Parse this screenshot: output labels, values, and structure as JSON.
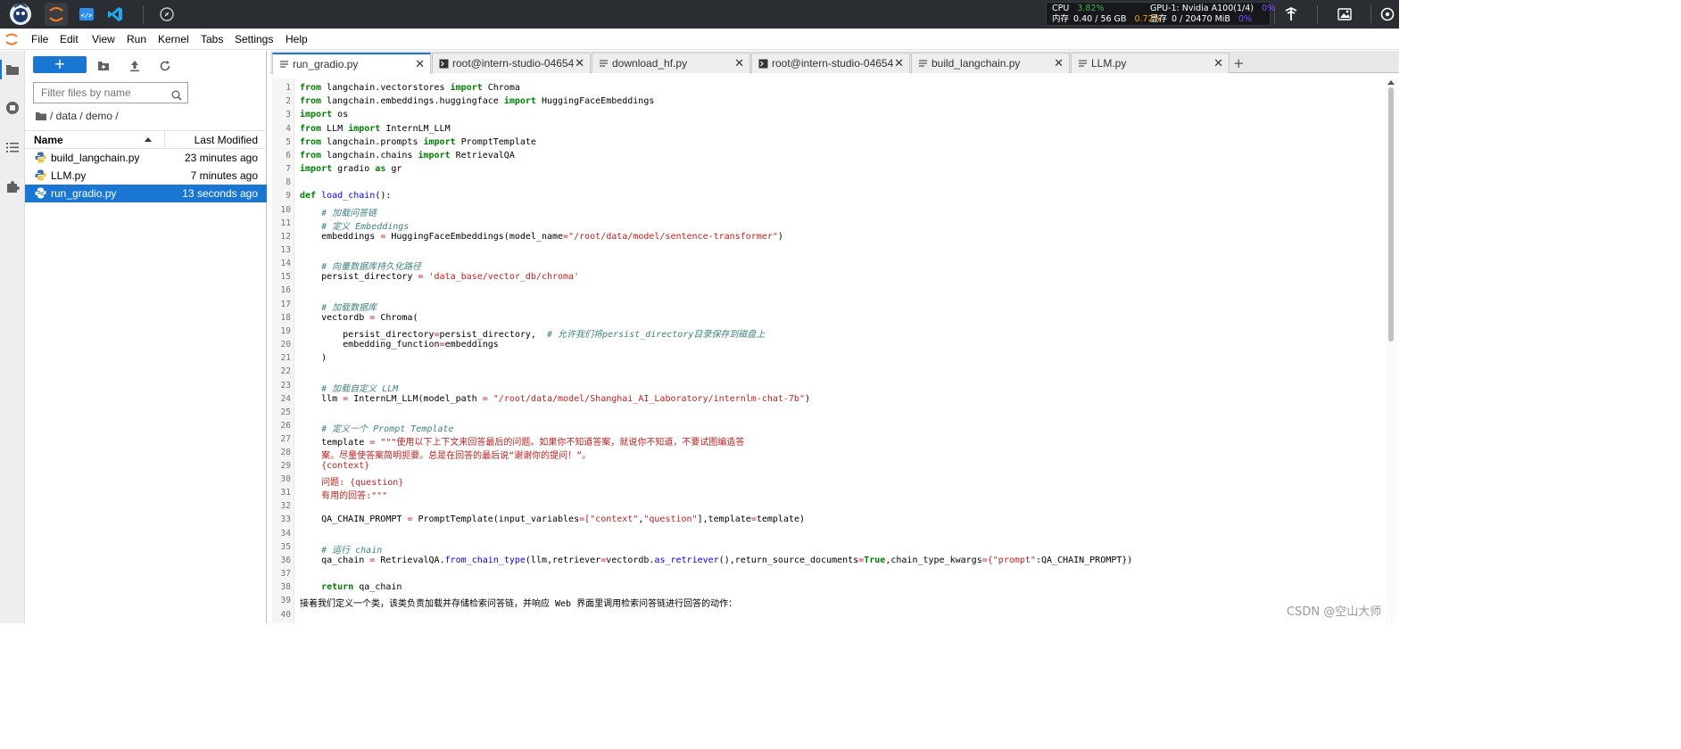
{
  "monitor": {
    "cpu_label": "CPU",
    "cpu_value": "3.82%",
    "mem_label": "内存",
    "mem_value": "0.40 / 56 GB",
    "mem_pct": "0.72%",
    "gpu_label": "GPU-1: Nvidia A100(1/4)",
    "gpu_pct": "0%",
    "vram_label": "显存",
    "vram_value": "0 / 20470 MiB",
    "vram_pct": "0%"
  },
  "menu": [
    "File",
    "Edit",
    "View",
    "Run",
    "Kernel",
    "Tabs",
    "Settings",
    "Help"
  ],
  "filebrowser": {
    "filter_placeholder": "Filter files by name",
    "breadcrumb": "/ data / demo /",
    "col_name": "Name",
    "col_modified": "Last Modified",
    "files": [
      {
        "name": "build_langchain.py",
        "modified": "23 minutes ago"
      },
      {
        "name": "LLM.py",
        "modified": "7 minutes ago"
      },
      {
        "name": "run_gradio.py",
        "modified": "13 seconds ago"
      }
    ]
  },
  "tabs": [
    {
      "label": "run_gradio.py",
      "kind": "file"
    },
    {
      "label": "root@intern-studio-04654",
      "kind": "terminal"
    },
    {
      "label": "download_hf.py",
      "kind": "file"
    },
    {
      "label": "root@intern-studio-04654",
      "kind": "terminal"
    },
    {
      "label": "build_langchain.py",
      "kind": "file"
    },
    {
      "label": "LLM.py",
      "kind": "file"
    }
  ],
  "code": {
    "line_numbers": [
      "1",
      "2",
      "3",
      "4",
      "5",
      "6",
      "7",
      "8",
      "9",
      "10",
      "11",
      "12",
      "13",
      "14",
      "15",
      "16",
      "17",
      "18",
      "19",
      "20",
      "21",
      "22",
      "23",
      "24",
      "25",
      "26",
      "27",
      "28",
      "29",
      "30",
      "31",
      "32",
      "33",
      "34",
      "35",
      "36",
      "37",
      "38",
      "39",
      "40"
    ],
    "l1a": "from",
    "l1b": " langchain.vectorstores ",
    "l1c": "import",
    "l1d": " Chroma",
    "l2a": "from",
    "l2b": " langchain.embeddings.huggingface ",
    "l2c": "import",
    "l2d": " HuggingFaceEmbeddings",
    "l3a": "import",
    "l3b": " os",
    "l4a": "from",
    "l4b": " LLM ",
    "l4c": "import",
    "l4d": " InternLM_LLM",
    "l5a": "from",
    "l5b": " langchain.prompts ",
    "l5c": "import",
    "l5d": " PromptTemplate",
    "l6a": "from",
    "l6b": " langchain.chains ",
    "l6c": "import",
    "l6d": " RetrievalQA",
    "l7a": "import",
    "l7b": " gradio ",
    "l7c": "as",
    "l7d": " gr",
    "l9a": "def",
    "l9b": " ",
    "l9c": "load_chain",
    "l9d": "():",
    "l10": "    # 加载问答链",
    "l11": "    # 定义 Embeddings",
    "l12a": "    embeddings ",
    "l12b": "=",
    "l12c": " HuggingFaceEmbeddings(model_name",
    "l12d": "=",
    "l12e": "\"/root/data/model/sentence-transformer\"",
    "l12f": ")",
    "l14": "    # 向量数据库持久化路径",
    "l15a": "    persist_directory ",
    "l15b": "=",
    "l15c": " ",
    "l15d": "'data_base/vector_db/chroma'",
    "l17": "    # 加载数据库",
    "l18a": "    vectordb ",
    "l18b": "=",
    "l18c": " Chroma(",
    "l19a": "        persist_directory",
    "l19b": "=",
    "l19c": "persist_directory,  ",
    "l19d": "# 允许我们将persist_directory目录保存到磁盘上",
    "l20a": "        embedding_function",
    "l20b": "=",
    "l20c": "embeddings",
    "l21": "    )",
    "l23": "    # 加载自定义 LLM",
    "l24a": "    llm ",
    "l24b": "=",
    "l24c": " InternLM_LLM(model_path ",
    "l24d": "=",
    "l24e": " ",
    "l24f": "\"/root/data/model/Shanghai_AI_Laboratory/internlm-chat-7b\"",
    "l24g": ")",
    "l26": "    # 定义一个 Prompt Template",
    "l27a": "    template ",
    "l27b": "=",
    "l27c": " ",
    "l27d": "\"\"\"使用以下上下文来回答最后的问题。如果你不知道答案，就说你不知道，不要试图编造答",
    "l28": "    案。尽量使答案简明扼要。总是在回答的最后说“谢谢你的提问！”。",
    "l29": "    {context}",
    "l30": "    问题: {question}",
    "l31": "    有用的回答:\"\"\"",
    "l33a": "    QA_CHAIN_PROMPT ",
    "l33b": "=",
    "l33c": " PromptTemplate(input_variables",
    "l33d": "=",
    "l33e": "[",
    "l33f": "\"context\"",
    "l33g": ",",
    "l33h": "\"question\"",
    "l33i": "],template",
    "l33j": "=",
    "l33k": "template)",
    "l35": "    # 运行 chain",
    "l36a": "    qa_chain ",
    "l36b": "=",
    "l36c": " RetrievalQA.",
    "l36d": "from_chain_type",
    "l36e": "(llm,retriever",
    "l36f": "=",
    "l36g": "vectordb.",
    "l36h": "as_retriever",
    "l36i": "(),return_source_documents",
    "l36j": "=",
    "l36k": "True",
    "l36l": ",chain_type_kwargs",
    "l36m": "=",
    "l36n": "{",
    "l36o": "\"prompt\"",
    "l36p": ":QA_CHAIN_PROMPT})",
    "l38a": "    ",
    "l38b": "return",
    "l38c": " qa_chain",
    "l39": "接着我们定义一个类，该类负责加载并存储检索问答链，并响应 Web 界面里调用检索问答链进行回答的动作："
  },
  "watermark": "CSDN @空山大师",
  "colors": {
    "accent": "#1976d2",
    "topbar": "#2a2d32",
    "keyword": "#008000",
    "comment": "#408080",
    "string": "#ba2121"
  }
}
